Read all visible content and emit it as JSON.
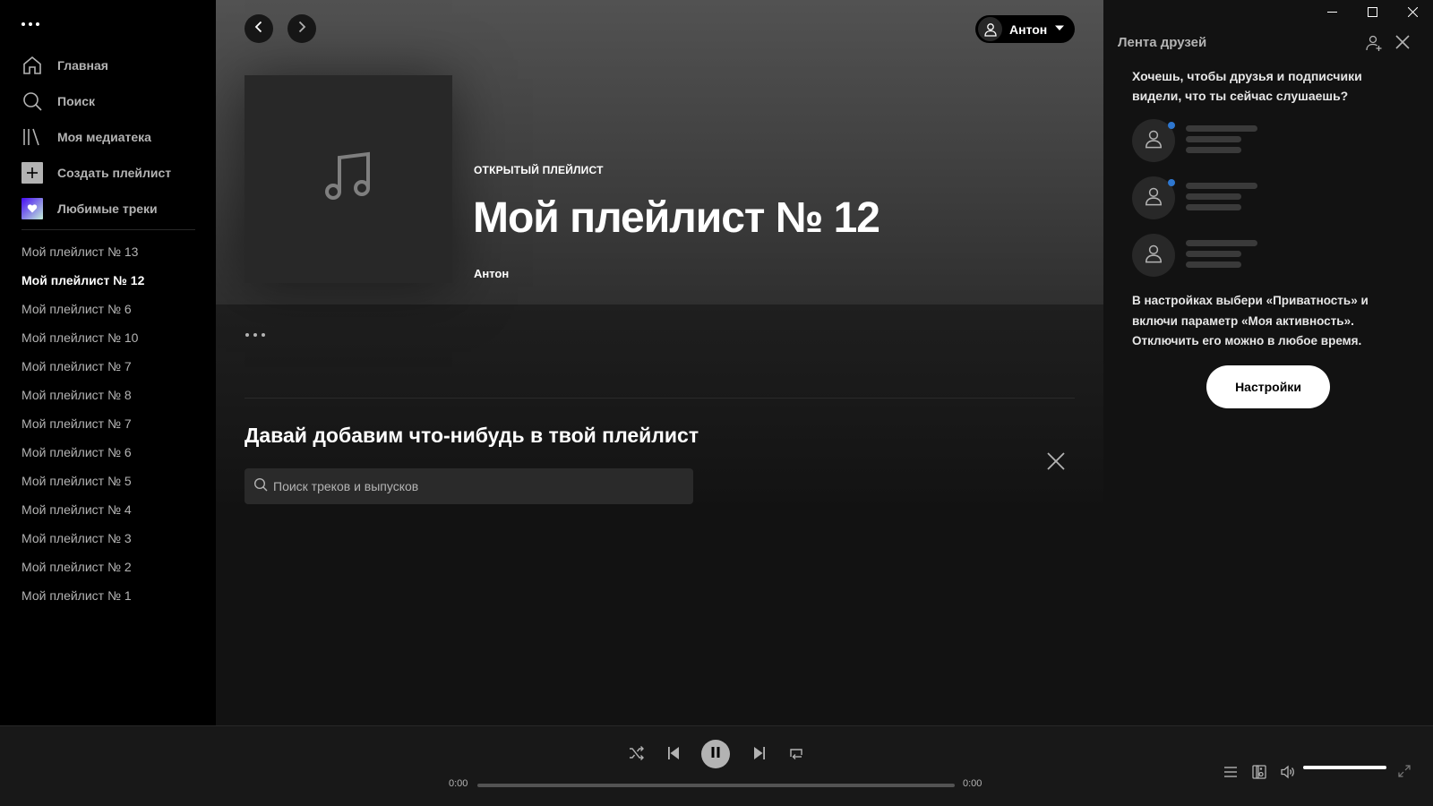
{
  "sidebar": {
    "nav": [
      {
        "label": "Главная",
        "icon": "home-icon"
      },
      {
        "label": "Поиск",
        "icon": "search-icon"
      },
      {
        "label": "Моя медиатека",
        "icon": "library-icon"
      }
    ],
    "create_label": "Создать плейлист",
    "liked_label": "Любимые треки",
    "playlists": [
      "Мой плейлист № 13",
      "Мой плейлист № 12",
      "Мой плейлист № 6",
      "Мой плейлист № 10",
      "Мой плейлист № 7",
      "Мой плейлист № 8",
      "Мой плейлист № 7",
      "Мой плейлист № 6",
      "Мой плейлист № 5",
      "Мой плейлист № 4",
      "Мой плейлист № 3",
      "Мой плейлист № 2",
      "Мой плейлист № 1"
    ],
    "active_playlist_index": 1
  },
  "header": {
    "user_name": "Антон"
  },
  "playlist": {
    "type_label": "ОТКРЫТЫЙ ПЛЕЙЛИСТ",
    "title": "Мой плейлист № 12",
    "owner": "Антон"
  },
  "add_section": {
    "title": "Давай добавим что-нибудь в твой плейлист",
    "search_placeholder": "Поиск треков и выпусков"
  },
  "friends": {
    "title": "Лента друзей",
    "intro": "Хочешь, чтобы друзья и подписчики видели, что ты сейчас слушаешь?",
    "hint": "В настройках выбери «Приватность» и включи параметр «Моя активность». Отключить его можно в любое время.",
    "settings_button": "Настройки"
  },
  "player": {
    "time_elapsed": "0:00",
    "time_total": "0:00",
    "progress": 0,
    "volume": 1.0
  },
  "colors": {
    "accent_dot": "#2e77d0",
    "bg": "#121212",
    "sidebar_bg": "#000000"
  }
}
